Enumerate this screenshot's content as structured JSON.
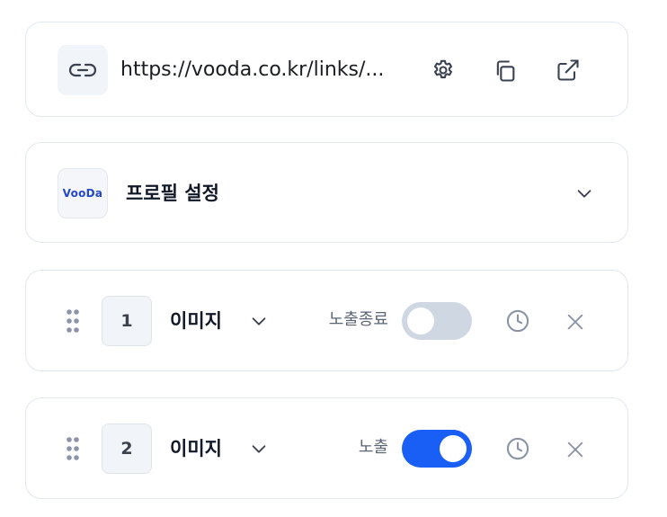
{
  "link_card": {
    "url": "https://vooda.co.kr/links/...",
    "icons": [
      "link-icon",
      "settings-icon",
      "copy-icon",
      "external-link-icon"
    ]
  },
  "profile_card": {
    "logo_text": "VooDa",
    "title": "프로필 설정",
    "icon": "chevron-down-icon"
  },
  "items": [
    {
      "number": "1",
      "title": "이미지",
      "status": "노출종료",
      "toggle_on": false
    },
    {
      "number": "2",
      "title": "이미지",
      "status": "노출",
      "toggle_on": true
    }
  ],
  "colors": {
    "accent": "#1a5ff5",
    "toggle_off": "#cfd7e2",
    "icon_gray": "#8a94a6",
    "border": "#e2e8f0"
  }
}
